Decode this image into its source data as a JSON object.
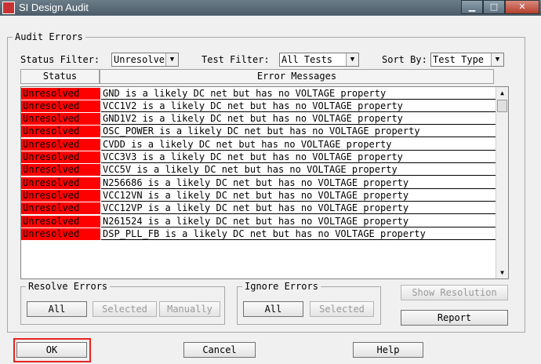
{
  "window": {
    "title": "SI Design Audit"
  },
  "audit_errors": {
    "group_label": "Audit Errors",
    "status_filter": {
      "label": "Status Filter:",
      "value": "Unresolve"
    },
    "test_filter": {
      "label": "Test Filter:",
      "value": "All Tests"
    },
    "sort_by": {
      "label": "Sort By:",
      "value": "Test Type"
    },
    "columns": {
      "status": "Status",
      "messages": "Error Messages"
    },
    "rows": [
      {
        "status": "Unresolved",
        "message": "GND is a likely DC net but has no VOLTAGE property"
      },
      {
        "status": "Unresolved",
        "message": "VCC1V2 is a likely DC net but has no VOLTAGE property"
      },
      {
        "status": "Unresolved",
        "message": "GND1V2 is a likely DC net but has no VOLTAGE property"
      },
      {
        "status": "Unresolved",
        "message": "OSC_POWER is a likely DC net but has no VOLTAGE property"
      },
      {
        "status": "Unresolved",
        "message": "CVDD is a likely DC net but has no VOLTAGE property"
      },
      {
        "status": "Unresolved",
        "message": "VCC3V3 is a likely DC net but has no VOLTAGE property"
      },
      {
        "status": "Unresolved",
        "message": "VCC5V is a likely DC net but has no VOLTAGE property"
      },
      {
        "status": "Unresolved",
        "message": "N256686 is a likely DC net but has no VOLTAGE property"
      },
      {
        "status": "Unresolved",
        "message": "VCC12VN is a likely DC net but has no VOLTAGE property"
      },
      {
        "status": "Unresolved",
        "message": "VCC12VP is a likely DC net but has no VOLTAGE property"
      },
      {
        "status": "Unresolved",
        "message": "N261524 is a likely DC net but has no VOLTAGE property"
      },
      {
        "status": "Unresolved",
        "message": "DSP_PLL_FB is a likely DC net but has no VOLTAGE property"
      }
    ],
    "status_color": "#ff0000"
  },
  "resolve_errors": {
    "group_label": "Resolve Errors",
    "all": "All",
    "selected": "Selected",
    "manually": "Manually"
  },
  "ignore_errors": {
    "group_label": "Ignore Errors",
    "all": "All",
    "selected": "Selected"
  },
  "actions": {
    "show_resolution": "Show Resolution",
    "report": "Report"
  },
  "footer": {
    "ok": "OK",
    "cancel": "Cancel",
    "help": "Help"
  },
  "icons": {
    "app": "app-icon",
    "minimize": "minimize-icon",
    "maximize": "maximize-icon",
    "close": "close-icon",
    "scroll_up": "arrow-up-icon",
    "scroll_down": "arrow-down-icon",
    "dropdown": "chevron-down-icon"
  }
}
